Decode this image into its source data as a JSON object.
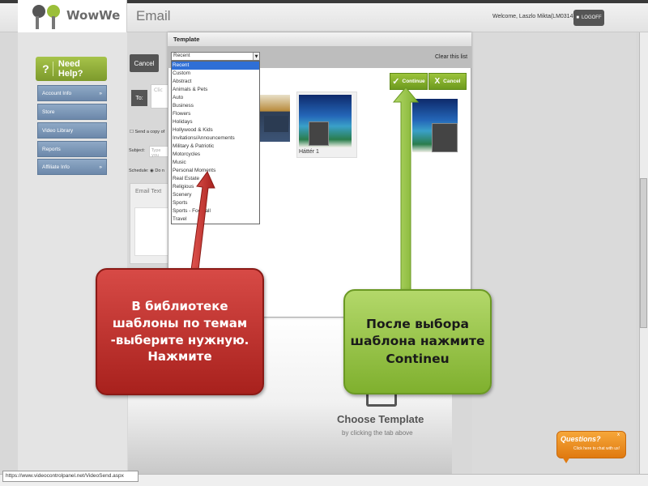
{
  "app": {
    "logo_text": "WowWe",
    "page_title": "Email"
  },
  "header": {
    "welcome": "Welcome, Laszlo Mikta(LM0314)",
    "logoff_label": "LOGOFF"
  },
  "sidebar": {
    "need_help": "Need Help?",
    "items": [
      {
        "label": "Account Info",
        "chevron": "»"
      },
      {
        "label": "Store",
        "chevron": ""
      },
      {
        "label": "Video Library",
        "chevron": ""
      },
      {
        "label": "Reports",
        "chevron": ""
      },
      {
        "label": "Affiliate Info",
        "chevron": "»"
      }
    ]
  },
  "email_form": {
    "cancel_label": "Cancel",
    "to_label": "To:",
    "to_placeholder": "Clic",
    "send_copy_label": "Send a copy of",
    "subject_label": "Subject:",
    "subject_placeholder": "Type you",
    "schedule_label": "Schedule:",
    "schedule_value": "Do n",
    "email_text_label": "Email Text"
  },
  "template_modal": {
    "title": "Template",
    "selected": "Recent",
    "select_arrow": "▼",
    "clear_list": "Clear this list",
    "continue_label": "Continue",
    "cancel_label": "Cancel",
    "options": [
      "Recent",
      "Custom",
      "Abstract",
      "Animals & Pets",
      "Auto",
      "Business",
      "Flowers",
      "Holidays",
      "Hollywood & Kids",
      "Invitations/Announcements",
      "Military & Patriotic",
      "Motorcycles",
      "Music",
      "Personal Moments",
      "Real Estate",
      "Religious",
      "Scenery",
      "Sports",
      "Sports - Football",
      "Travel"
    ],
    "templates": [
      {
        "label": ""
      },
      {
        "label": "Háttér 1"
      },
      {
        "label": ""
      }
    ]
  },
  "choose_template": {
    "title": "Choose Template",
    "subtitle": "by clicking the tab above"
  },
  "annotations": {
    "red_callout": "В библиотеке шаблоны по темам -выберите нужную. Нажмите",
    "green_callout": "После выбора шаблона нажмите Contineu",
    "red_color": "#c0302b",
    "green_color": "#8cc63f"
  },
  "chat_widget": {
    "title": "Questions?",
    "subtitle": "Click here to chat with us!",
    "close": "x"
  },
  "status_bar": {
    "url": "https://www.videocontrolpanel.net/VideoSend.aspx"
  }
}
